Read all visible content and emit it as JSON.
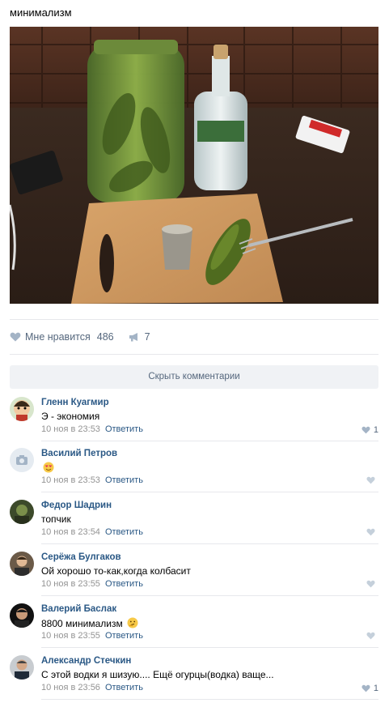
{
  "post": {
    "text": "минимализм"
  },
  "actions": {
    "like_label": "Мне нравится",
    "like_count": "486",
    "share_count": "7"
  },
  "comments_toggle": "Скрыть комментарии",
  "comments": [
    {
      "author": "Гленн Куагмир",
      "text": "Э - экономия",
      "date": "10 ноя в 23:53",
      "reply": "Ответить",
      "likes": "1",
      "avatar_icon": "cartoon-avatar"
    },
    {
      "author": "Василий Петров",
      "text": "",
      "emoji": "heart-eyes-emoji",
      "date": "10 ноя в 23:53",
      "reply": "Ответить",
      "likes": "",
      "avatar_icon": "camera-icon"
    },
    {
      "author": "Федор Шадрин",
      "text": "топчик",
      "date": "10 ноя в 23:54",
      "reply": "Ответить",
      "likes": "",
      "avatar_icon": "photo-avatar"
    },
    {
      "author": "Серёжа Булгаков",
      "text": "Ой хорошо то-как,когда колбасит",
      "date": "10 ноя в 23:55",
      "reply": "Ответить",
      "likes": "",
      "avatar_icon": "photo-avatar"
    },
    {
      "author": "Валерий Баслак",
      "text": "8800 минимализм",
      "emoji": "thinking-emoji",
      "date": "10 ноя в 23:55",
      "reply": "Ответить",
      "likes": "",
      "avatar_icon": "photo-avatar"
    },
    {
      "author": "Александр Стечкин",
      "text": "С этой водки я шизую.... Ещё огурцы(водка) ваще...",
      "date": "10 ноя в 23:56",
      "reply": "Ответить",
      "likes": "1",
      "avatar_icon": "photo-avatar"
    }
  ],
  "colors": {
    "link": "#2a5885",
    "meta": "#939393",
    "action": "#55677d",
    "divider": "#e7e8ec",
    "button_bg": "#f0f2f5"
  }
}
